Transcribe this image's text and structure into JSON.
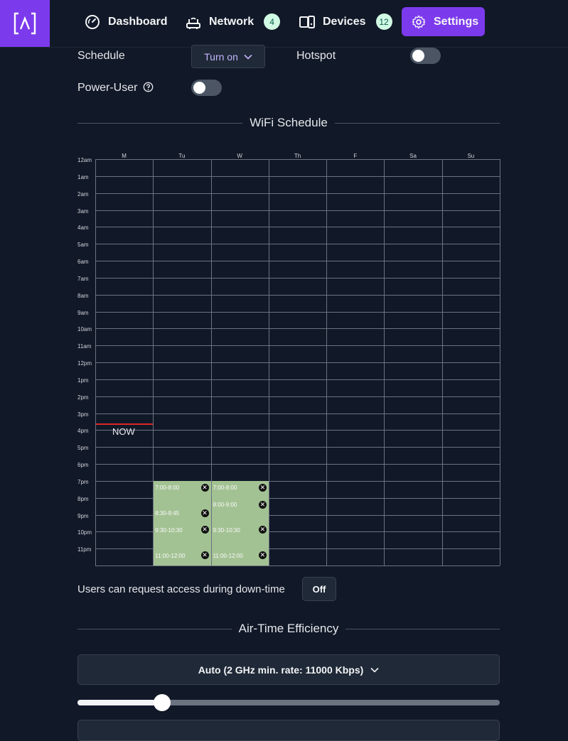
{
  "colors": {
    "accent": "#7c3aed",
    "background": "#111827",
    "now_line": "#dc2626",
    "block": "#a3c293",
    "badge_bg": "#d1fae5"
  },
  "nav": {
    "items": [
      {
        "label": "Dashboard",
        "icon": "gauge-icon",
        "badge": null
      },
      {
        "label": "Network",
        "icon": "router-icon",
        "badge": "4"
      },
      {
        "label": "Devices",
        "icon": "devices-icon",
        "badge": "12"
      },
      {
        "label": "Settings",
        "icon": "gear-icon",
        "badge": null,
        "active": true
      }
    ]
  },
  "settings": {
    "schedule_label": "Schedule",
    "schedule_value": "Turn on",
    "hotspot_label": "Hotspot",
    "hotspot_on": false,
    "power_user_label": "Power-User",
    "power_user_on": false
  },
  "wifi_schedule": {
    "title": "WiFi Schedule",
    "days": [
      "M",
      "Tu",
      "W",
      "Th",
      "F",
      "Sa",
      "Su"
    ],
    "hours": [
      "12am",
      "1am",
      "2am",
      "3am",
      "4am",
      "5am",
      "6am",
      "7am",
      "8am",
      "9am",
      "10am",
      "11am",
      "12pm",
      "1pm",
      "2pm",
      "3pm",
      "4pm",
      "5pm",
      "6pm",
      "7pm",
      "8pm",
      "9pm",
      "10pm",
      "11pm"
    ],
    "now_label": "NOW",
    "now_hour": 15.6,
    "now_day": "M",
    "slots": [
      {
        "day": "Tu",
        "label": "7:00-8:00",
        "start": 19.0,
        "end": 20.0
      },
      {
        "day": "Tu",
        "label": "8:30-9:45",
        "start": 20.5,
        "end": 21.75
      },
      {
        "day": "Tu",
        "label": "9:30-10:30",
        "start": 21.5,
        "end": 22.5
      },
      {
        "day": "Tu",
        "label": "11:00-12:00",
        "start": 23.0,
        "end": 24.0
      },
      {
        "day": "W",
        "label": "7:00-8:00",
        "start": 19.0,
        "end": 20.0
      },
      {
        "day": "W",
        "label": "8:00-9:00",
        "start": 20.0,
        "end": 21.0
      },
      {
        "day": "W",
        "label": "9:30-10:30",
        "start": 21.5,
        "end": 22.5
      },
      {
        "day": "W",
        "label": "11:00-12:00",
        "start": 23.0,
        "end": 24.0
      }
    ]
  },
  "access": {
    "label": "Users can request access during down-time",
    "button": "Off"
  },
  "airtime": {
    "title": "Air-Time Efficiency",
    "select_value": "Auto (2 GHz min. rate: 11000 Kbps)",
    "slider_fraction": 0.2
  }
}
